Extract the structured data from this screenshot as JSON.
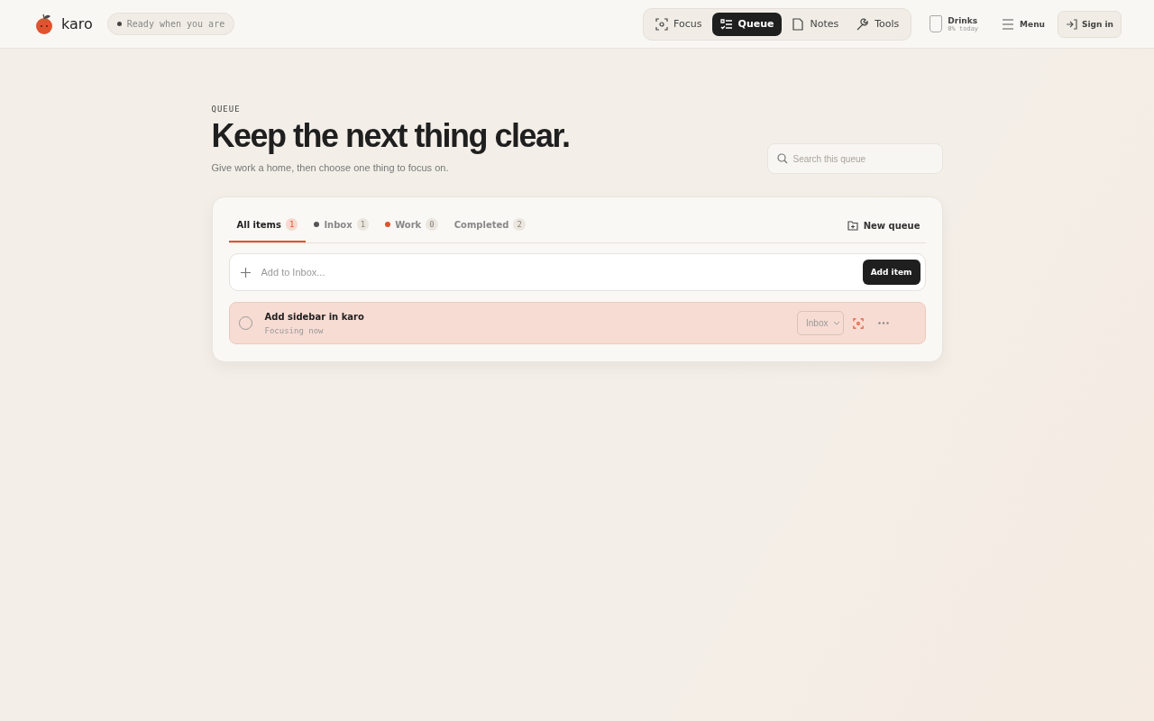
{
  "brand": {
    "name": "karo"
  },
  "status": {
    "text": "Ready when you are"
  },
  "nav": [
    {
      "label": "Focus",
      "kind": "focus",
      "selected": false
    },
    {
      "label": "Queue",
      "kind": "list",
      "selected": true
    },
    {
      "label": "Notes",
      "kind": "note",
      "selected": false
    },
    {
      "label": "Tools",
      "kind": "wrench",
      "selected": false
    }
  ],
  "drinks": {
    "label": "Drinks",
    "reading": "0% today"
  },
  "menu": {
    "label": "Menu"
  },
  "sign_in": {
    "label": "Sign in"
  },
  "eyebrow": "QUEUE",
  "title": "Keep the next thing clear.",
  "subtitle": "Give work a home, then choose one thing to focus on.",
  "search": {
    "placeholder": "Search this queue"
  },
  "tabs": [
    {
      "label": "All items",
      "count": "1",
      "selected": true
    },
    {
      "label": "Inbox",
      "count": "1",
      "color": "#555555",
      "selected": false
    },
    {
      "label": "Work",
      "count": "0",
      "color": "#e0532f",
      "selected": false
    },
    {
      "label": "Completed",
      "count": "2",
      "selected": false
    }
  ],
  "new_queue": {
    "label": "New queue"
  },
  "add": {
    "placeholder": "Add to Inbox...",
    "button": "Add item"
  },
  "items": [
    {
      "title": "Add sidebar in karo",
      "note": "Focusing now",
      "checked": false,
      "focused": true,
      "queue": "Inbox"
    }
  ]
}
